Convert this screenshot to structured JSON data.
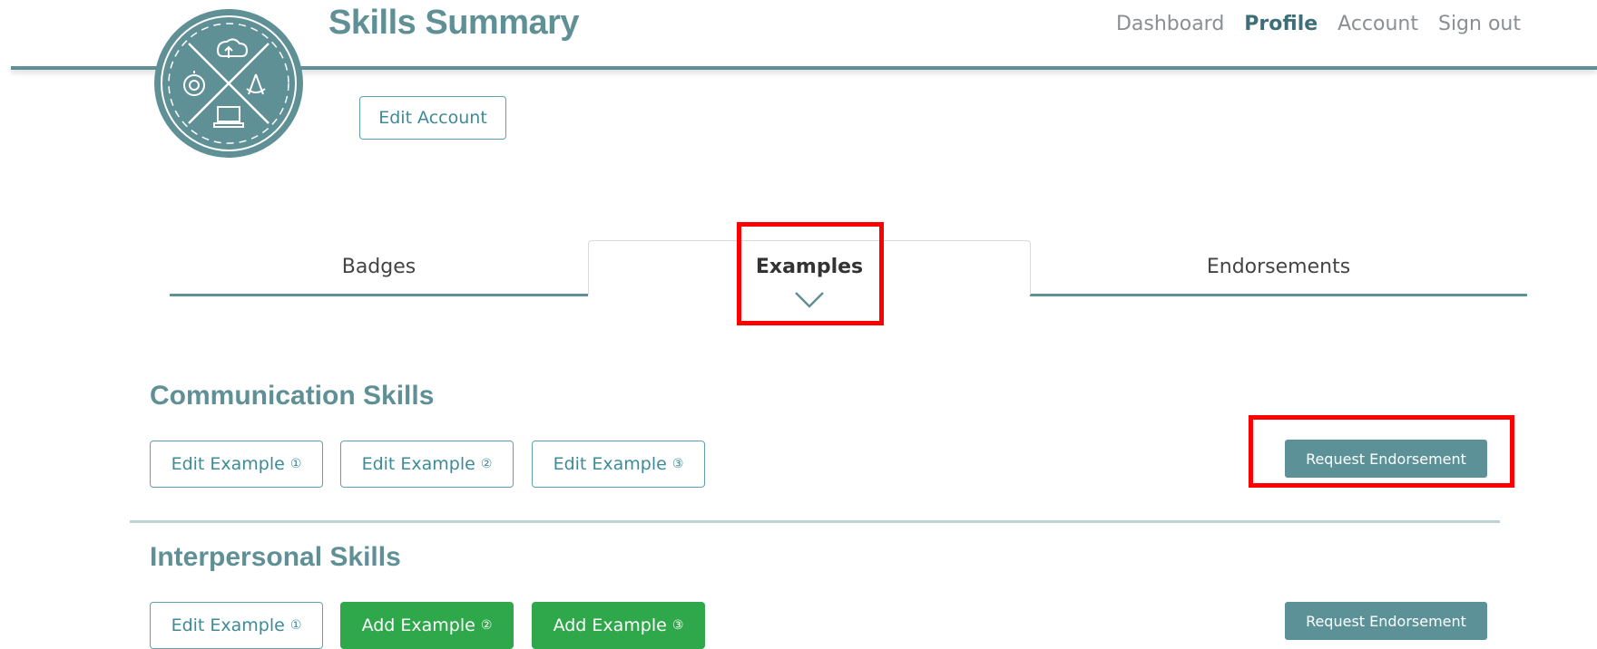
{
  "header": {
    "title": "Skills Summary",
    "nav": [
      {
        "label": "Dashboard",
        "active": false
      },
      {
        "label": "Profile",
        "active": true
      },
      {
        "label": "Account",
        "active": false
      },
      {
        "label": "Sign out",
        "active": false
      }
    ]
  },
  "account": {
    "edit_label": "Edit Account"
  },
  "tabs": {
    "badges": "Badges",
    "examples": "Examples",
    "endorsements": "Endorsements",
    "active": "examples"
  },
  "sections": [
    {
      "title": "Communication Skills",
      "buttons": [
        {
          "label": "Edit Example",
          "num": "①",
          "style": "outline"
        },
        {
          "label": "Edit Example",
          "num": "②",
          "style": "outline"
        },
        {
          "label": "Edit Example",
          "num": "③",
          "style": "outline"
        }
      ],
      "request_label": "Request Endorsement"
    },
    {
      "title": "Interpersonal Skills",
      "buttons": [
        {
          "label": "Edit Example",
          "num": "①",
          "style": "outline"
        },
        {
          "label": "Add Example",
          "num": "②",
          "style": "green"
        },
        {
          "label": "Add Example",
          "num": "③",
          "style": "green"
        }
      ],
      "request_label": "Request Endorsement"
    }
  ],
  "colors": {
    "brand": "#5f9096",
    "outline": "#5fa2ad",
    "green": "#2ea84a",
    "highlight": "#ff0000"
  },
  "icons": [
    "cloud-icon",
    "compass-icon",
    "drafting-compass-icon",
    "computer-icon"
  ]
}
